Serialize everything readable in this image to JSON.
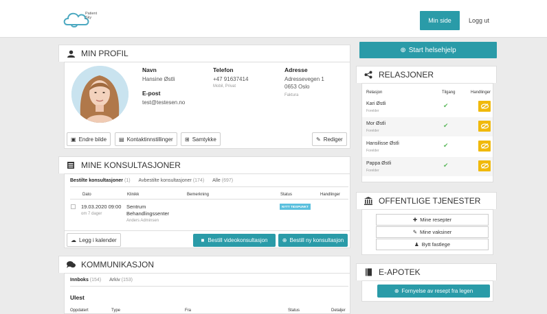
{
  "header": {
    "logo_line1": "Patient",
    "logo_line2": "Sky",
    "min_side": "Min side",
    "logg_ut": "Logg ut"
  },
  "profile": {
    "title": "MIN PROFIL",
    "navn_label": "Navn",
    "navn": "Hansine Østli",
    "telefon_label": "Telefon",
    "telefon": "+47 91637414",
    "telefon_sub": "Mobil, Privat",
    "adresse_label": "Adresse",
    "adresse_line1": "Adressevegen 1",
    "adresse_line2": "0653 Oslo",
    "adresse_sub": "Faktura",
    "epost_label": "E-post",
    "epost": "test@testesen.no",
    "btn_endre_bilde": "Endre bilde",
    "btn_kontakt": "Kontaktinnstillinger",
    "btn_samtykke": "Samtykke",
    "btn_rediger": "Rediger"
  },
  "konsultasjoner": {
    "title": "MINE KONSULTASJONER",
    "tabs": [
      {
        "label": "Bestilte konsultasjoner",
        "count": "(1)"
      },
      {
        "label": "Avbestilte konsultasjoner",
        "count": "(174)"
      },
      {
        "label": "Alle",
        "count": "(697)"
      }
    ],
    "columns": [
      "Dato",
      "Klinikk",
      "Bemerkning",
      "Status",
      "Handlinger"
    ],
    "row": {
      "dato": "19.03.2020 09:00",
      "dato_sub": "om 7 dager",
      "klinikk1": "Sentrum",
      "klinikk2": "Behandlingssenter",
      "klinikk_sub": "Anders Adminsen",
      "status": "NYTT TIDSPUNKT"
    },
    "btn_kalender": "Legg i kalender",
    "btn_video": "Bestill videokonsultasjon",
    "btn_ny": "Bestill ny konsultasjon"
  },
  "kommunikasjon": {
    "title": "KOMMUNIKASJON",
    "tabs": [
      {
        "label": "Innboks",
        "count": "(154)"
      },
      {
        "label": "Arkiv",
        "count": "(153)"
      }
    ],
    "section": "Ulest",
    "columns": [
      "Oppdatert",
      "Type",
      "Fra",
      "Status",
      "Detaljer"
    ]
  },
  "right": {
    "start_btn": "Start helsehjelp",
    "relasjoner": {
      "title": "RELASJONER",
      "columns": [
        "Relasjon",
        "Tilgang",
        "Handlinger"
      ],
      "rows": [
        {
          "name": "Kari Østli",
          "role": "Forelder"
        },
        {
          "name": "Mor Østli",
          "role": "Forelder"
        },
        {
          "name": "Hansilisse Østli",
          "role": "Forelder"
        },
        {
          "name": "Pappa Østli",
          "role": "Forelder"
        }
      ]
    },
    "offentlige": {
      "title": "OFFENTLIGE TJENESTER",
      "buttons": [
        "Mine resepter",
        "Mine vaksiner",
        "Bytt fastlege"
      ]
    },
    "eapotek": {
      "title": "E-APOTEK",
      "button": "Fornyelse av resept fra legen"
    }
  },
  "colors": {
    "teal": "#2a9ba8",
    "yellow": "#f0b90b",
    "badge": "#5bc0de"
  }
}
